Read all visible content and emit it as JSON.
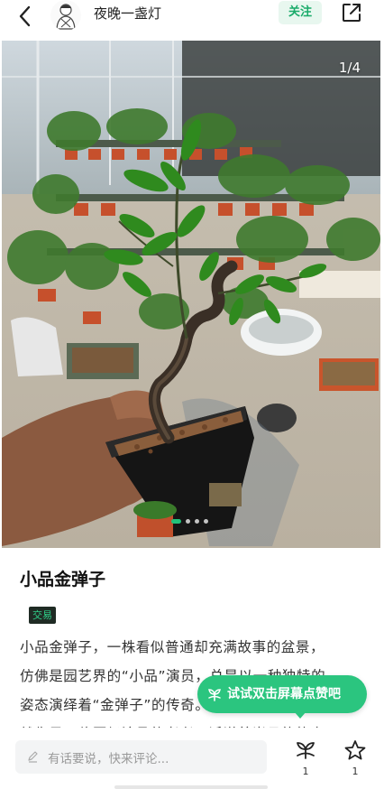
{
  "header": {
    "author_name": "夜晚一盏灯",
    "follow_label": "关注"
  },
  "gallery": {
    "page_indicator": "1/4",
    "current_index": 1,
    "total": 4
  },
  "post": {
    "title": "小品金弹子",
    "tag": "交易",
    "body_lines": [
      "小品金弹子，一株看似普通却充满故事的盆景，",
      "仿佛是园艺界的“小品”演员，总是以一种独特的",
      "姿态演绎着“金弹子”的传奇。它那婀娜的身姿，",
      "就像是一位历经沧桑的老者，诉说着岁月的故事；"
    ]
  },
  "toast": {
    "text": "试试双击屏幕点赞吧"
  },
  "bottom_bar": {
    "comment_placeholder": "有话要说，快来评论...",
    "like_count": "1",
    "favorite_count": "1"
  },
  "colors": {
    "accent": "#2bc57f",
    "follow_text": "#1aab6a",
    "follow_bg": "#e8f7ef",
    "tag_bg": "#1f2b24",
    "tag_text": "#2fd08a"
  },
  "icons": [
    "back-arrow-icon",
    "share-icon",
    "pen-icon",
    "sprout-icon",
    "star-icon"
  ]
}
